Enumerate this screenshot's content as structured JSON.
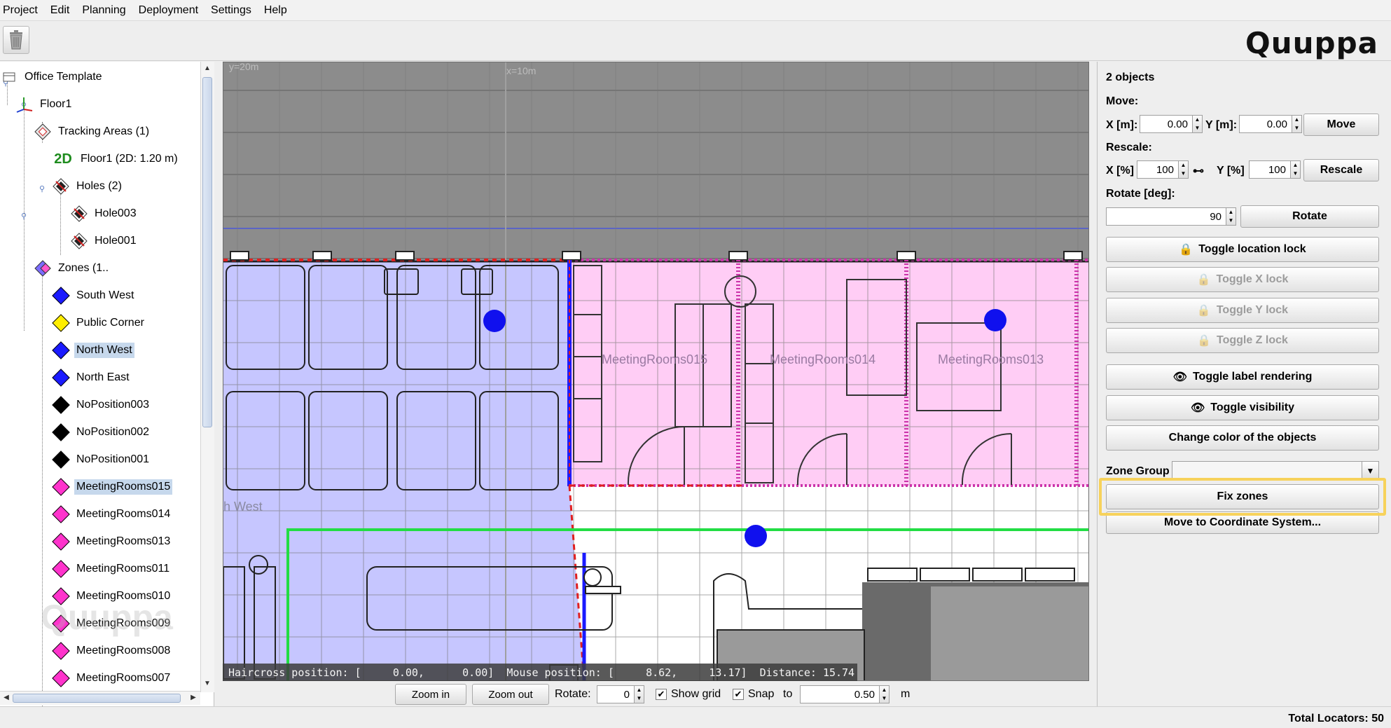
{
  "menu": [
    {
      "label": "Project"
    },
    {
      "label": "Edit"
    },
    {
      "label": "Planning"
    },
    {
      "label": "Deployment"
    },
    {
      "label": "Settings"
    },
    {
      "label": "Help"
    }
  ],
  "toolbar": {
    "logo": "Quuppa",
    "trash_icon": "trash-icon"
  },
  "tree": {
    "items": [
      {
        "label": "Office Template",
        "icon": "project-icon"
      },
      {
        "label": "Floor1",
        "icon": "axes-icon"
      },
      {
        "label": "Tracking Areas (1)",
        "icon": "diamond-icon"
      },
      {
        "label": "Floor1 (2D: 1.20 m)",
        "icon": "2d-icon",
        "icon_text": "2D"
      },
      {
        "label": "Holes (2)",
        "icon": "holes-icon"
      },
      {
        "label": "Hole003",
        "icon": "hole-icon"
      },
      {
        "label": "Hole001",
        "icon": "hole-icon"
      },
      {
        "label": "Zones (1..",
        "icon": "zones-icon"
      },
      {
        "label": "South West",
        "color": "#1a1aff"
      },
      {
        "label": "Public Corner",
        "color": "#ffee00"
      },
      {
        "label": "North West",
        "color": "#1a1aff",
        "selected": true
      },
      {
        "label": "North East",
        "color": "#1a1aff"
      },
      {
        "label": "NoPosition003",
        "color": "#000000"
      },
      {
        "label": "NoPosition002",
        "color": "#000000"
      },
      {
        "label": "NoPosition001",
        "color": "#000000"
      },
      {
        "label": "MeetingRooms015",
        "color": "#ff33cc",
        "selected": true
      },
      {
        "label": "MeetingRooms014",
        "color": "#ff33cc"
      },
      {
        "label": "MeetingRooms013",
        "color": "#ff33cc"
      },
      {
        "label": "MeetingRooms011",
        "color": "#ff33cc"
      },
      {
        "label": "MeetingRooms010",
        "color": "#ff33cc"
      },
      {
        "label": "MeetingRooms009",
        "color": "#ff33cc"
      },
      {
        "label": "MeetingRooms008",
        "color": "#ff33cc"
      },
      {
        "label": "MeetingRooms007",
        "color": "#ff33cc"
      }
    ]
  },
  "canvas": {
    "ruler_y": "y=20m",
    "ruler_x": "x=10m",
    "room_labels": [
      "MeetingRooms015",
      "MeetingRooms014",
      "MeetingRooms013"
    ],
    "zone_label": "h West",
    "status": {
      "haircross_label": "Haircross position: [",
      "haircross_x": "0.00,",
      "haircross_y": "0.00]",
      "mouse_label": "Mouse position: [",
      "mouse_x": "8.62,",
      "mouse_y": "13.17]",
      "distance_label": "Distance:",
      "distance": "15.74"
    }
  },
  "bottom": {
    "zoom_in": "Zoom in",
    "zoom_out": "Zoom out",
    "rotate_label": "Rotate:",
    "rotate_value": "0",
    "show_grid": "Show grid",
    "show_grid_checked": true,
    "snap": "Snap",
    "snap_checked": true,
    "to_label": "to",
    "snap_value": "0.50",
    "unit": "m"
  },
  "right_panel": {
    "objects_count": "2 objects",
    "move_label": "Move:",
    "x_m_label": "X [m]:",
    "x_m_value": "0.00",
    "y_m_label": "Y [m]:",
    "y_m_value": "0.00",
    "move_button": "Move",
    "rescale_label": "Rescale:",
    "x_pct_label": "X [%]",
    "x_pct_value": "100",
    "y_pct_label": "Y [%]",
    "y_pct_value": "100",
    "rescale_button": "Rescale",
    "rotate_label": "Rotate [deg]:",
    "rotate_value": "90",
    "rotate_button": "Rotate",
    "toggle_location_lock": "Toggle location lock",
    "toggle_x_lock": "Toggle X lock",
    "toggle_y_lock": "Toggle Y lock",
    "toggle_z_lock": "Toggle Z lock",
    "toggle_label_rendering": "Toggle label rendering",
    "toggle_visibility": "Toggle visibility",
    "change_color": "Change color of the objects",
    "zone_group_label": "Zone Group",
    "zone_group_value": "",
    "fix_zones": "Fix zones",
    "move_to_cs": "Move to Coordinate System..."
  },
  "footer": {
    "total_locators": "Total Locators: 50"
  }
}
